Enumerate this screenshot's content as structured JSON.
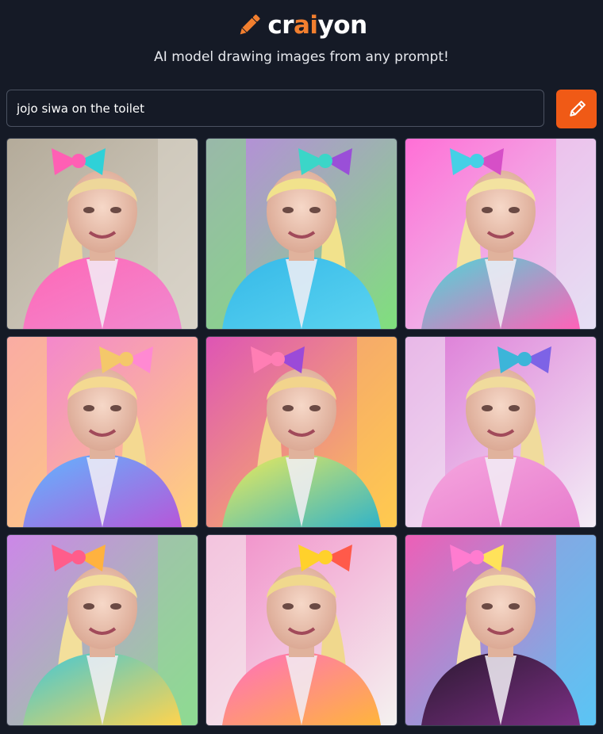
{
  "header": {
    "logo_prefix": "cr",
    "logo_accent": "ai",
    "logo_suffix": "yon",
    "logo_icon": "pencil-icon",
    "tagline": "AI model drawing images from any prompt!"
  },
  "prompt": {
    "value": "jojo siwa on the toilet",
    "button_icon": "pencil-icon"
  },
  "colors": {
    "background": "#151a26",
    "accent": "#f05a16",
    "logo_accent": "#f27f2f"
  },
  "results": {
    "images": [
      {
        "bg": "#b4ab9a",
        "bow": [
          "#ff5fb4",
          "#2fd1d8"
        ],
        "hair": "#eed79a",
        "jacket": [
          "#ff67b6",
          "#f08ad0"
        ],
        "side": "#d8d3c8"
      },
      {
        "bg": "#b988e0",
        "bow": [
          "#3bd6c8",
          "#9a4fd8"
        ],
        "hair": "#f1e28c",
        "jacket": [
          "#35b8e8",
          "#5bd4f0"
        ],
        "side": "#7fe07c"
      },
      {
        "bg": "#ff6fd6",
        "bow": [
          "#45d0e6",
          "#d64fc7"
        ],
        "hair": "#f3e2a0",
        "jacket": [
          "#4ad8d8",
          "#ff62b8"
        ],
        "side": "#e5e0f4"
      },
      {
        "bg": "#f27fd5",
        "bow": [
          "#f4c86a",
          "#ff89d2"
        ],
        "hair": "#f4d991",
        "jacket": [
          "#5fb7ff",
          "#b657d9"
        ],
        "side": "#ffd27a"
      },
      {
        "bg": "#de55b5",
        "bow": [
          "#ff7eb4",
          "#9b4ad8"
        ],
        "hair": "#f2d48c",
        "jacket": [
          "#efeb58",
          "#32b4c8"
        ],
        "side": "#ffcb4f"
      },
      {
        "bg": "#dc77d6",
        "bow": [
          "#3cb5d9",
          "#7d63e6"
        ],
        "hair": "#f0db9c",
        "jacket": [
          "#f6a7df",
          "#e77ccd"
        ],
        "side": "#f3edf6"
      },
      {
        "bg": "#cc87e8",
        "bow": [
          "#ff5d8b",
          "#ffb23f"
        ],
        "hair": "#f3df9b",
        "jacket": [
          "#3fc7d8",
          "#ffd44e"
        ],
        "side": "#8edb91"
      },
      {
        "bg": "#f28bc8",
        "bow": [
          "#ffd12b",
          "#ff5a4a"
        ],
        "hair": "#f0d88d",
        "jacket": [
          "#ff6ec1",
          "#ffb53c"
        ],
        "side": "#f4f2f0"
      },
      {
        "bg": "#ed5fb7",
        "bow": [
          "#ff7cd0",
          "#ffe25a"
        ],
        "hair": "#f5e2a8",
        "jacket": [
          "#2b1930",
          "#7b2f84"
        ],
        "side": "#5bc4f4"
      }
    ]
  }
}
